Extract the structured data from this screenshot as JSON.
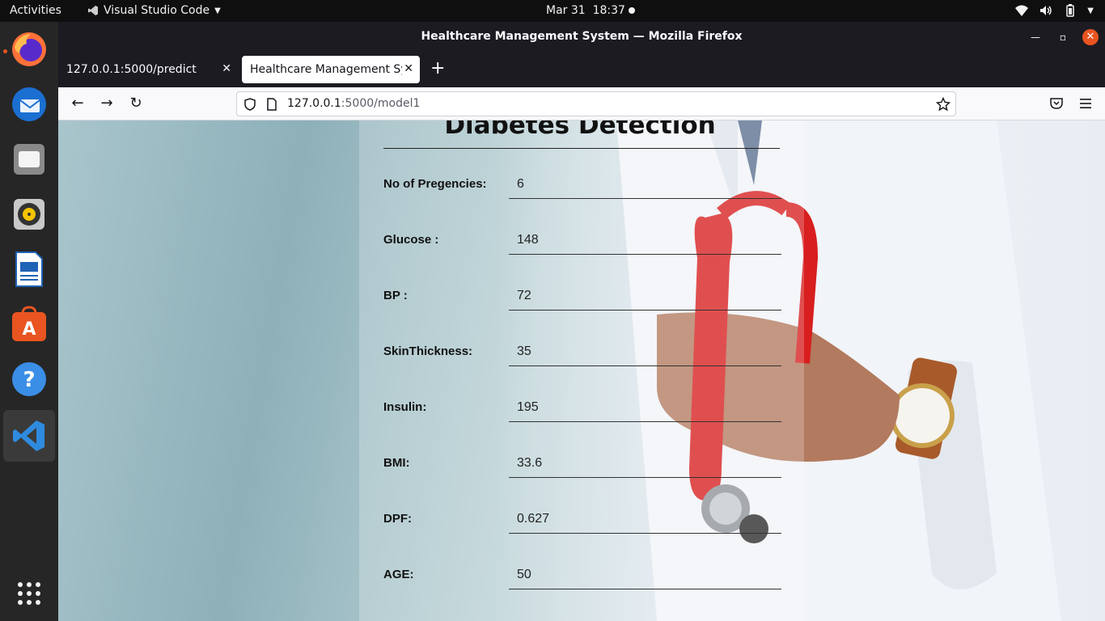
{
  "topbar": {
    "activities": "Activities",
    "app_menu": "Visual Studio Code",
    "date": "Mar 31",
    "time": "18:37"
  },
  "dock": {
    "items": [
      "firefox-icon",
      "thunderbird-icon",
      "files-icon",
      "rhythmbox-icon",
      "libreoffice-writer-icon",
      "app-center-icon",
      "help-icon",
      "vscode-icon",
      "show-apps-icon"
    ]
  },
  "window": {
    "title": "Healthcare Management System — Mozilla Firefox"
  },
  "tabs": [
    {
      "label": "127.0.0.1:5000/predict"
    },
    {
      "label": "Healthcare Management System"
    }
  ],
  "urlbar": {
    "host": "127.0.0.1",
    "path": ":5000/model1"
  },
  "page": {
    "heading": "Diabetes Detection",
    "fields": [
      {
        "label": "No of Pregencies:",
        "value": "6"
      },
      {
        "label": "Glucose :",
        "value": "148"
      },
      {
        "label": "BP :",
        "value": "72"
      },
      {
        "label": "SkinThickness:",
        "value": "35"
      },
      {
        "label": "Insulin:",
        "value": "195"
      },
      {
        "label": "BMI:",
        "value": "33.6"
      },
      {
        "label": "DPF:",
        "value": "0.627"
      },
      {
        "label": "AGE:",
        "value": "50"
      }
    ]
  },
  "colors": {
    "ubuntu_orange": "#e95420",
    "firefox_dark": "#1c1b22"
  }
}
